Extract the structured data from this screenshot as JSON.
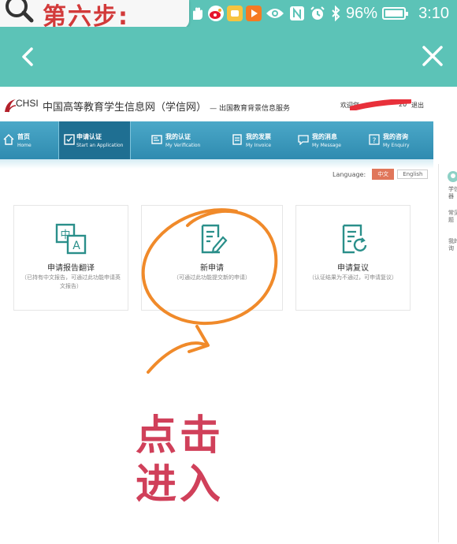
{
  "status_bar": {
    "overlay_text": "第六步:",
    "battery": "96%",
    "time": "3:10"
  },
  "app_bar": {
    "back_icon": "chevron-left",
    "close_icon": "close-x"
  },
  "site": {
    "logo_text": "CHSI",
    "title": "中国高等教育学生信息网（学信网）",
    "subtitle": "— 出国教育背景信息服务",
    "welcome": "欢迎您",
    "welcome_suffix": "20",
    "logout": "退出"
  },
  "nav": [
    {
      "title": "首页",
      "sub": "Home",
      "icon": "home-icon"
    },
    {
      "title": "申请认证",
      "sub": "Start an Application",
      "icon": "apply-icon"
    },
    {
      "title": "我的认证",
      "sub": "My Verification",
      "icon": "verification-icon"
    },
    {
      "title": "我的发票",
      "sub": "My Invoice",
      "icon": "invoice-icon"
    },
    {
      "title": "我的消息",
      "sub": "My Message",
      "icon": "message-icon"
    },
    {
      "title": "我的咨询",
      "sub": "My Enquiry",
      "icon": "enquiry-icon"
    }
  ],
  "language": {
    "label": "Language:",
    "options": [
      "中文",
      "English"
    ],
    "selected": "中文"
  },
  "cards": [
    {
      "title": "申请报告翻译",
      "desc": "（已持有中文报告，可通过此功能申请英文报告）"
    },
    {
      "title": "新申请",
      "desc": "（可通过此功能提交新的申请）"
    },
    {
      "title": "申请复议",
      "desc": "（认证结果为不通过，可申请复议）"
    }
  ],
  "side_widget": {
    "items": [
      "学信机器",
      "常见问题",
      "我的咨询"
    ]
  },
  "annotation": {
    "line1": "点击",
    "line2": "进入"
  },
  "colors": {
    "teal_bar": "#5cc3b7",
    "nav_blue": "#2f8bb0",
    "icon_teal": "#2a8f8a",
    "annotation_orange": "#f08a2a",
    "annotation_red": "#d0405a"
  }
}
